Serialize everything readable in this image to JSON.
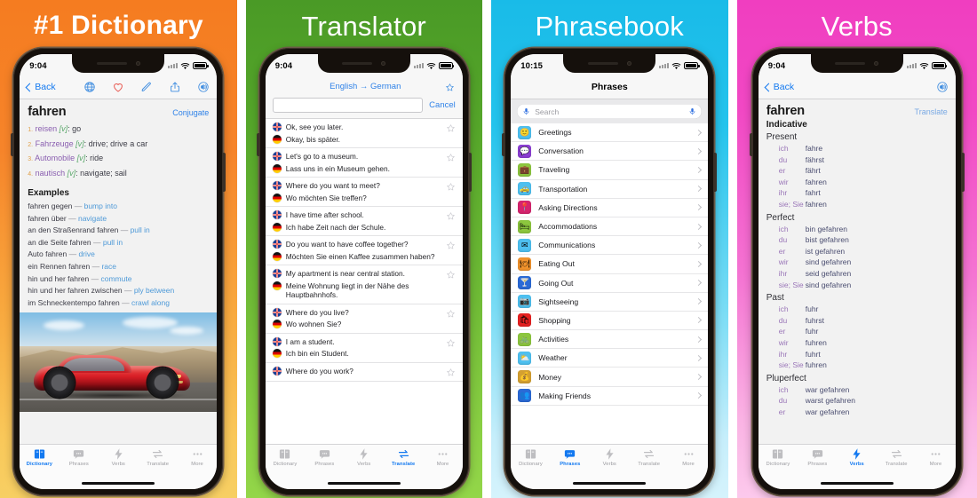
{
  "panels": [
    {
      "title": "#1 Dictionary",
      "bg_from": "#f57c20",
      "bg_to": "#f7cf63",
      "status": {
        "time": "9:04"
      },
      "nav": {
        "back_label": "Back"
      },
      "nav_icons": [
        "globe-icon",
        "heart-icon",
        "pencil-icon",
        "share-icon",
        "speaker-icon"
      ],
      "word": "fahren",
      "action_link": "Conjugate",
      "definitions": [
        {
          "num": "1.",
          "german": "reisen",
          "pos": "[v]",
          "english": ": go"
        },
        {
          "num": "2.",
          "german": "Fahrzeuge",
          "pos": "[v]",
          "english": ": drive;  drive a car"
        },
        {
          "num": "3.",
          "german": "Automobile",
          "pos": "[v]",
          "english": ": ride"
        },
        {
          "num": "4.",
          "german": "nautisch",
          "pos": "[v]",
          "english": ": navigate;  sail"
        }
      ],
      "examples_header": "Examples",
      "examples": [
        {
          "de": "fahren gegen",
          "en": "bump into"
        },
        {
          "de": "fahren über",
          "en": "navigate"
        },
        {
          "de": "an den Straßenrand fahren",
          "en": "pull in"
        },
        {
          "de": "an die Seite fahren",
          "en": "pull in"
        },
        {
          "de": "Auto fahren",
          "en": "drive"
        },
        {
          "de": "ein Rennen fahren",
          "en": "race"
        },
        {
          "de": "hin und her fahren",
          "en": "commute"
        },
        {
          "de": "hin und her fahren zwischen",
          "en": "ply between"
        },
        {
          "de": "im Schneckentempo fahren",
          "en": "crawl along"
        }
      ],
      "image_caption": "red sports car on road",
      "active_tab": "Dictionary"
    },
    {
      "title": "Translator",
      "bg_from": "#4a9a26",
      "bg_to": "#93d649",
      "status": {
        "time": "9:04"
      },
      "language_pair": "English → German",
      "search_value": "",
      "cancel_label": "Cancel",
      "phrases": [
        {
          "en": "Ok, see you later.",
          "de": "Okay, bis später."
        },
        {
          "en": "Let's go to a museum.",
          "de": "Lass uns in ein Museum gehen."
        },
        {
          "en": "Where do you want to meet?",
          "de": "Wo möchten Sie treffen?"
        },
        {
          "en": "I have time after school.",
          "de": "Ich habe Zeit nach der Schule."
        },
        {
          "en": "Do you want to have coffee together?",
          "de": "Möchten Sie einen Kaffee zusammen haben?"
        },
        {
          "en": "My apartment is near central station.",
          "de": "Meine Wohnung liegt in der Nähe des Hauptbahnhofs."
        },
        {
          "en": "Where do you live?",
          "de": "Wo wohnen Sie?"
        },
        {
          "en": "I am a student.",
          "de": "Ich bin ein Student."
        },
        {
          "en": "Where do you work?",
          "de": ""
        }
      ],
      "active_tab": "Translate"
    },
    {
      "title": "Phrasebook",
      "bg_from": "#19bbe8",
      "bg_to": "#d5f3fc",
      "status": {
        "time": "10:15"
      },
      "nav_title": "Phrases",
      "search_placeholder": "Search",
      "categories": [
        {
          "label": "Greetings",
          "icon": "smiley-icon",
          "color": "#4ec0f0",
          "glyph": "🙂"
        },
        {
          "label": "Conversation",
          "icon": "speech-bubble-icon",
          "color": "#8c3fd4",
          "glyph": "💬"
        },
        {
          "label": "Traveling",
          "icon": "suitcase-icon",
          "color": "#8cc63e",
          "glyph": "💼"
        },
        {
          "label": "Transportation",
          "icon": "taxi-icon",
          "color": "#4ec0f0",
          "glyph": "🚕"
        },
        {
          "label": "Asking Directions",
          "icon": "map-pin-icon",
          "color": "#d6246e",
          "glyph": "📍"
        },
        {
          "label": "Accommodations",
          "icon": "bed-icon",
          "color": "#8cc63e",
          "glyph": "🛏"
        },
        {
          "label": "Communications",
          "icon": "envelope-icon",
          "color": "#4ec0f0",
          "glyph": "✉"
        },
        {
          "label": "Eating Out",
          "icon": "chef-hat-icon",
          "color": "#f0922c",
          "glyph": "🍽"
        },
        {
          "label": "Going Out",
          "icon": "cocktail-icon",
          "color": "#2a6ad6",
          "glyph": "🍸"
        },
        {
          "label": "Sightseeing",
          "icon": "camera-icon",
          "color": "#4ec0f0",
          "glyph": "📷"
        },
        {
          "label": "Shopping",
          "icon": "shopping-bag-icon",
          "color": "#e62020",
          "glyph": "🛍"
        },
        {
          "label": "Activities",
          "icon": "bicycle-icon",
          "color": "#8cc63e",
          "glyph": "🚲"
        },
        {
          "label": "Weather",
          "icon": "sun-cloud-icon",
          "color": "#4ec0f0",
          "glyph": "⛅"
        },
        {
          "label": "Money",
          "icon": "money-icon",
          "color": "#d4a030",
          "glyph": "💰"
        },
        {
          "label": "Making Friends",
          "icon": "people-icon",
          "color": "#2a6ad6",
          "glyph": "👥"
        }
      ],
      "active_tab": "Phrases"
    },
    {
      "title": "Verbs",
      "bg_from": "#f03ec0",
      "bg_to": "#fcc9ec",
      "status": {
        "time": "9:04"
      },
      "nav": {
        "back_label": "Back"
      },
      "nav_icons": [
        "speaker-icon"
      ],
      "word": "fahren",
      "action_link": "Translate",
      "mood": "Indicative",
      "tenses": [
        {
          "name": "Present",
          "rows": [
            {
              "pronoun": "ich",
              "form": "fahre"
            },
            {
              "pronoun": "du",
              "form": "fährst"
            },
            {
              "pronoun": "er",
              "form": "fährt"
            },
            {
              "pronoun": "wir",
              "form": "fahren"
            },
            {
              "pronoun": "ihr",
              "form": "fahrt"
            },
            {
              "pronoun": "sie; Sie",
              "form": "fahren"
            }
          ]
        },
        {
          "name": "Perfect",
          "rows": [
            {
              "pronoun": "ich",
              "form": "bin gefahren"
            },
            {
              "pronoun": "du",
              "form": "bist gefahren"
            },
            {
              "pronoun": "er",
              "form": "ist gefahren"
            },
            {
              "pronoun": "wir",
              "form": "sind gefahren"
            },
            {
              "pronoun": "ihr",
              "form": "seid gefahren"
            },
            {
              "pronoun": "sie; Sie",
              "form": "sind gefahren"
            }
          ]
        },
        {
          "name": "Past",
          "rows": [
            {
              "pronoun": "ich",
              "form": "fuhr"
            },
            {
              "pronoun": "du",
              "form": "fuhrst"
            },
            {
              "pronoun": "er",
              "form": "fuhr"
            },
            {
              "pronoun": "wir",
              "form": "fuhren"
            },
            {
              "pronoun": "ihr",
              "form": "fuhrt"
            },
            {
              "pronoun": "sie; Sie",
              "form": "fuhren"
            }
          ]
        },
        {
          "name": "Pluperfect",
          "rows": [
            {
              "pronoun": "ich",
              "form": "war gefahren"
            },
            {
              "pronoun": "du",
              "form": "warst gefahren"
            },
            {
              "pronoun": "er",
              "form": "war gefahren"
            }
          ]
        }
      ],
      "active_tab": "Verbs"
    }
  ],
  "tabs": [
    {
      "label": "Dictionary",
      "icon": "book-icon"
    },
    {
      "label": "Phrases",
      "icon": "speech-bubble-icon"
    },
    {
      "label": "Verbs",
      "icon": "bolt-icon"
    },
    {
      "label": "Translate",
      "icon": "swap-arrows-icon"
    },
    {
      "label": "More",
      "icon": "ellipsis-icon"
    }
  ],
  "colors": {
    "accent": "#1379f0",
    "heart": "#e8564e",
    "link": "#2f82e8"
  }
}
